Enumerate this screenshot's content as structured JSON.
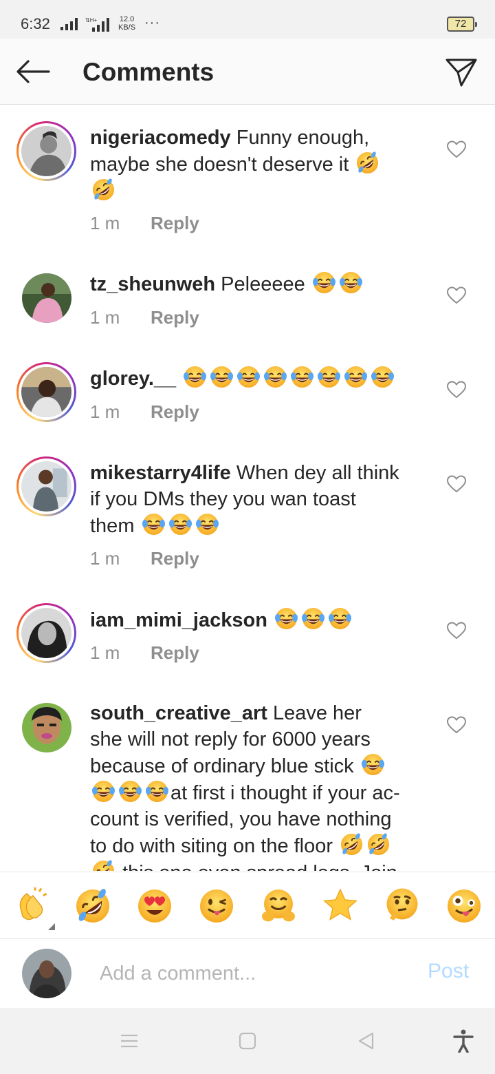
{
  "status_bar": {
    "time": "6:32",
    "net_speed_value": "12.0",
    "net_speed_unit": "KB/S",
    "battery": "72"
  },
  "header": {
    "title": "Comments"
  },
  "comments": [
    {
      "username": "nigeriacomedy",
      "text": "Funny enough, maybe she doesn't deserve it",
      "time": "1 m",
      "reply": "Reply"
    },
    {
      "username": "tz_sheunweh",
      "text": "Peleeeee",
      "time": "1 m",
      "reply": "Reply"
    },
    {
      "username": "glorey.__",
      "text": "",
      "time": "1 m",
      "reply": "Reply"
    },
    {
      "username": "mikestarry4life",
      "text_line1": "When dey all think",
      "text_line2": "if you DMs they you wan toast",
      "text_line3": "them",
      "time": "1 m",
      "reply": "Reply"
    },
    {
      "username": "iam_mimi_jackson",
      "text": "",
      "time": "1 m",
      "reply": "Reply"
    },
    {
      "username": "south_creative_art",
      "line1": "Leave her",
      "line2": "she will not reply for 6000 years",
      "line3": "because of ordinary blue stick",
      "line4": "at first i thought if your ac-",
      "line5": "count is verified, you have nothing",
      "line6": "to do with siting on the floor",
      "line7": "this one even spread legs. Join"
    }
  ],
  "emoji_bar": [
    "clapping-hands",
    "rolling-on-floor-laughing",
    "heart-eyes",
    "winking-tongue",
    "hugging-face",
    "star",
    "thinking-face",
    "zany-face"
  ],
  "composer": {
    "placeholder": "Add a comment...",
    "post_label": "Post"
  },
  "colors": {
    "link_disabled": "#b3dbff",
    "muted": "#8e8e8e",
    "text": "#262626"
  }
}
